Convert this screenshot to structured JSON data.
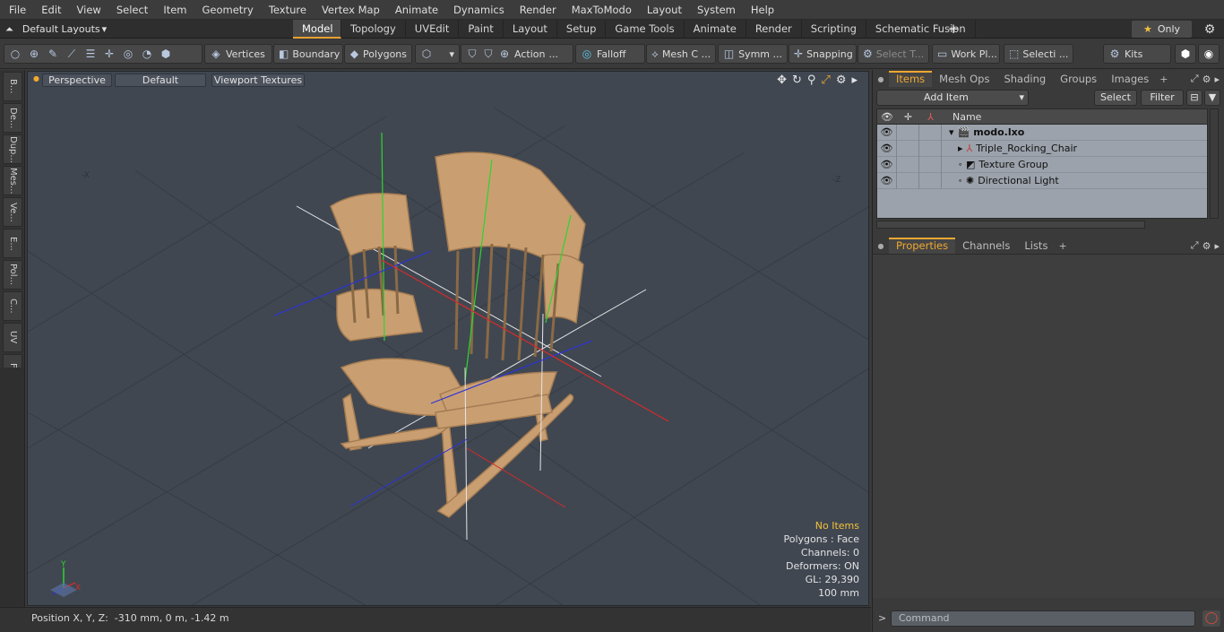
{
  "menu": [
    "File",
    "Edit",
    "View",
    "Select",
    "Item",
    "Geometry",
    "Texture",
    "Vertex Map",
    "Animate",
    "Dynamics",
    "Render",
    "MaxToModo",
    "Layout",
    "System",
    "Help"
  ],
  "layout_selector": "Default Layouts",
  "mode_tabs": [
    {
      "label": "Model",
      "active": true
    },
    {
      "label": "Topology"
    },
    {
      "label": "UVEdit"
    },
    {
      "label": "Paint"
    },
    {
      "label": "Layout"
    },
    {
      "label": "Setup"
    },
    {
      "label": "Game Tools"
    },
    {
      "label": "Animate"
    },
    {
      "label": "Render"
    },
    {
      "label": "Scripting"
    },
    {
      "label": "Schematic Fusion"
    }
  ],
  "only_label": "Only",
  "toolbar": {
    "vertices": "Vertices",
    "boundary": "Boundary",
    "polygons": "Polygons",
    "action": "Action",
    "falloff": "Falloff",
    "mesh": "Mesh C ...",
    "symm": "Symm ...",
    "snapping": "Snapping",
    "select_t": "Select T...",
    "work_pl": "Work Pl...",
    "selecti": "Selecti ...",
    "kits": "Kits"
  },
  "left_tabs": [
    "B...",
    "De...",
    "Dup...",
    "Mes...",
    "Ve...",
    "E...",
    "Pol...",
    "C...",
    "UV",
    "F..."
  ],
  "viewport": {
    "view": "Perspective",
    "shading": "Default",
    "textures": "Viewport Textures",
    "stats": {
      "items": "No Items",
      "polygons": "Polygons : Face",
      "channels": "Channels: 0",
      "deformers": "Deformers: ON",
      "gl": "GL: 29,390",
      "scale": "100 mm"
    },
    "axis_x": "X",
    "axis_y": "Y",
    "corner_left": "-X",
    "corner_right": "-Z"
  },
  "status_text": "Position X, Y, Z:  -310 mm, 0 m, -1.42 m",
  "items_panel": {
    "tabs": [
      {
        "label": "Items",
        "active": true
      },
      {
        "label": "Mesh Ops"
      },
      {
        "label": "Shading"
      },
      {
        "label": "Groups"
      },
      {
        "label": "Images"
      }
    ],
    "add_item": "Add Item",
    "select": "Select",
    "filter": "Filter",
    "column_name": "Name",
    "rows": [
      {
        "name": "modo.lxo",
        "bold": true
      },
      {
        "name": "Triple_Rocking_Chair"
      },
      {
        "name": "Texture Group"
      },
      {
        "name": "Directional Light"
      }
    ]
  },
  "props_panel": {
    "tabs": [
      {
        "label": "Properties",
        "active": true
      },
      {
        "label": "Channels"
      },
      {
        "label": "Lists"
      }
    ]
  },
  "command_placeholder": "Command",
  "colors": {
    "accent": "#f0a830",
    "viewport_bg": "#404751",
    "chair": "#c99f72"
  }
}
